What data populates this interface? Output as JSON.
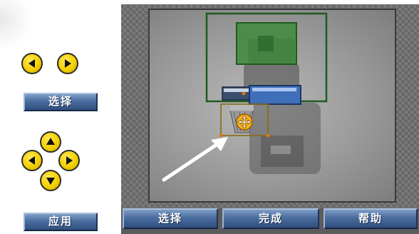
{
  "left_panel": {
    "select_button": "选择",
    "apply_button": "应用"
  },
  "bottom_bar": {
    "select_button": "选择",
    "done_button": "完成",
    "help_button": "帮助"
  },
  "icons": {
    "left_arrow": "arrow-left-icon",
    "right_arrow": "arrow-right-icon",
    "dpad_up": "arrow-up-icon",
    "dpad_down": "arrow-down-icon",
    "dpad_left": "arrow-left-icon",
    "dpad_right": "arrow-right-icon",
    "move_cursor": "move-icon",
    "pointer_arrow": "pointer-arrow-icon"
  },
  "colors": {
    "button_blue": "#4a6d9f",
    "arrow_yellow": "#f4cf00",
    "frame_green": "#1f5a1f",
    "target_green": "#3d8a3d",
    "selection_orange": "#e07a10"
  }
}
